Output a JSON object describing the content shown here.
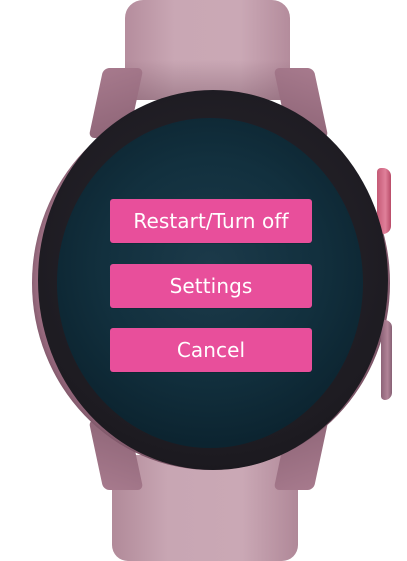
{
  "menu": {
    "restart_label": "Restart/Turn off",
    "settings_label": "Settings",
    "cancel_label": "Cancel"
  },
  "colors": {
    "button_background": "#e84f9b",
    "button_text": "#ffffff",
    "screen_background": "#12303e",
    "strap": "#c9a7b4",
    "bezel": "#1d1b21",
    "side_button_accent": "#e0809a"
  }
}
